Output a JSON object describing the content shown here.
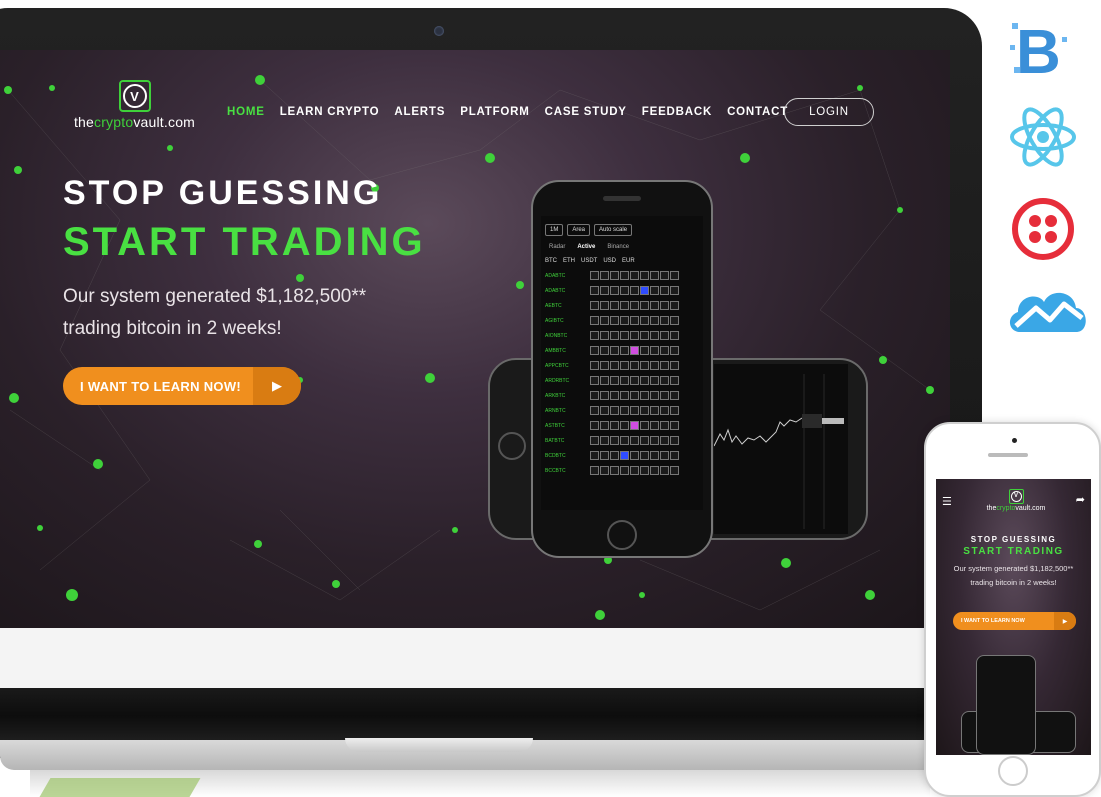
{
  "brand": {
    "name_prefix": "the",
    "name_middle": "crypto",
    "name_suffix": "vault.com",
    "badge_letter": "V",
    "accent_green": "#49e042",
    "accent_orange": "#f08f1e"
  },
  "nav": {
    "items": [
      {
        "label": "HOME",
        "active": true
      },
      {
        "label": "LEARN CRYPTO",
        "active": false
      },
      {
        "label": "ALERTS",
        "active": false
      },
      {
        "label": "PLATFORM",
        "active": false
      },
      {
        "label": "CASE STUDY",
        "active": false
      },
      {
        "label": "FEEDBACK",
        "active": false
      },
      {
        "label": "CONTACT",
        "active": false
      }
    ],
    "login_label": "LOGIN"
  },
  "hero": {
    "headline_1": "STOP GUESSING",
    "headline_2": "START TRADING",
    "subtext_line1": "Our system generated $1,182,500**",
    "subtext_line2": "trading bitcoin in 2 weeks!",
    "cta_label": "I WANT TO LEARN NOW!",
    "cta_icon": "play-arrow-icon"
  },
  "phone_app": {
    "toolbar": [
      "1M",
      "Area",
      "Auto scale"
    ],
    "tabs": [
      "Radar",
      "Active",
      "Binance"
    ],
    "filters": [
      "BTC",
      "ETH",
      "USDT",
      "USD",
      "EUR"
    ],
    "symbols": [
      "ADABTC",
      "ADABTC",
      "AEBTC",
      "AGIBTC",
      "AIONBTC",
      "AMBBTC",
      "APPCBTC",
      "ARDRBTC",
      "ARKBTC",
      "ARNBTC",
      "ASTBTC",
      "BATBTC",
      "BCDBTC",
      "BCCBTC"
    ]
  },
  "side_icons": [
    "blockchain-b-icon",
    "react-atom-icon",
    "twilio-icon",
    "cloud-chart-icon"
  ],
  "mobile": {
    "headline_1": "STOP GUESSING",
    "headline_2": "START TRADING",
    "subtext_line1": "Our system generated $1,182,500**",
    "subtext_line2": "trading bitcoin in 2 weeks!",
    "cta_label": "I WANT TO LEARN NOW"
  }
}
